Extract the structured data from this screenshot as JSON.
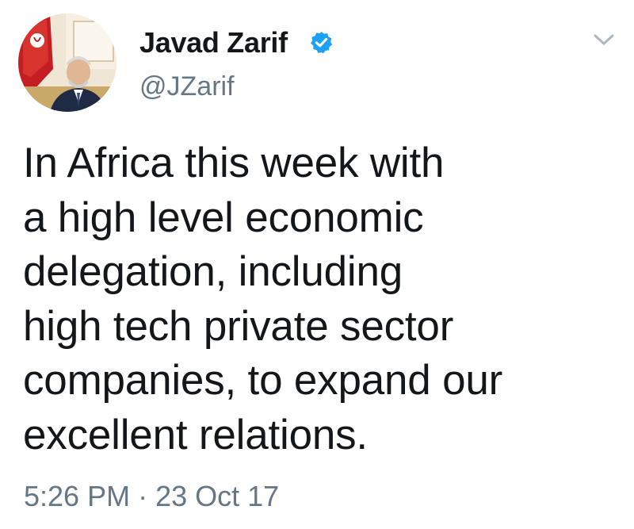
{
  "user": {
    "display_name": "Javad Zarif",
    "handle": "@JZarif",
    "verified": true
  },
  "icons": {
    "verified": "verified-badge-icon",
    "menu": "chevron-down-icon",
    "avatar": "profile-photo"
  },
  "tweet": {
    "lines": [
      "In Africa this week with",
      "a high level economic",
      "delegation, including",
      "high tech private sector",
      "companies, to expand our",
      "excellent relations."
    ],
    "time": "5:26 PM",
    "separator": "·",
    "date": "23 Oct 17"
  },
  "colors": {
    "text": "#14171a",
    "secondary": "#657786",
    "verified_blue": "#1da1f2",
    "chevron": "#aab8c2"
  }
}
